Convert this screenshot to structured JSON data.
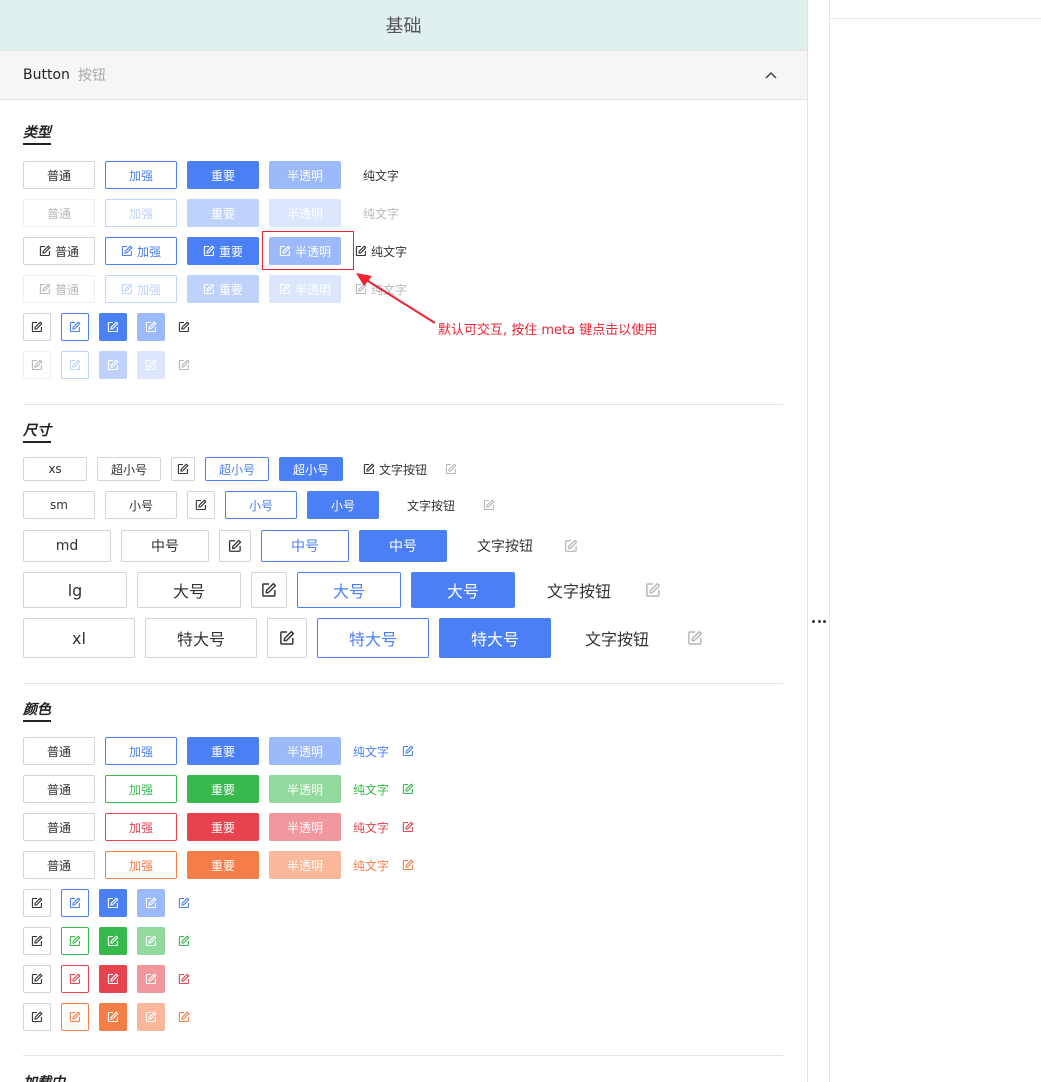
{
  "header": {
    "title": "基础"
  },
  "section": {
    "title": "Button",
    "subtitle": "按钮"
  },
  "colors": {
    "blue": "#4b7ff5",
    "green": "#37b94d",
    "red": "#e6434f",
    "orange": "#f47d48",
    "annotation": "#e23333"
  },
  "groups": {
    "type": {
      "title": "类型"
    },
    "size": {
      "title": "尺寸"
    },
    "color": {
      "title": "颜色"
    },
    "loading": {
      "title": "加载中"
    }
  },
  "labels": {
    "normal": "普通",
    "strong": "加强",
    "important": "重要",
    "translucent": "半透明",
    "text": "纯文字"
  },
  "sizes": [
    {
      "name": "xs",
      "label": "超小号",
      "text_label": "文字按钮"
    },
    {
      "name": "sm",
      "label": "小号",
      "text_label": "文字按钮"
    },
    {
      "name": "md",
      "label": "中号",
      "text_label": "文字按钮"
    },
    {
      "name": "lg",
      "label": "大号",
      "text_label": "文字按钮"
    },
    {
      "name": "xl",
      "label": "特大号",
      "text_label": "文字按钮"
    }
  ],
  "annotation": {
    "text": "默认可交互, 按住 meta 键点击以使用"
  },
  "icons": {
    "edit": "edit-icon",
    "collapse": "chevron-up-icon",
    "splitter": "more-horizontal-icon"
  }
}
